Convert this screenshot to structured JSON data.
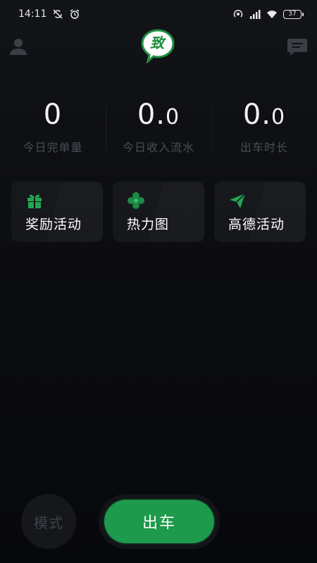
{
  "status_bar": {
    "time": "14:11",
    "battery": "37",
    "icons": [
      "sync-off-icon",
      "alarm-icon",
      "hotspot-icon",
      "signal-icon",
      "wifi-icon",
      "battery-icon"
    ]
  },
  "header": {
    "logo_text": "致",
    "left_icon": "user-icon",
    "right_icon": "message-icon"
  },
  "stats": [
    {
      "value": "0",
      "label": "今日完单量"
    },
    {
      "value_int": "0.",
      "value_dec": "0",
      "label": "今日收入流水"
    },
    {
      "value_int": "0.",
      "value_dec": "0",
      "label": "出车时长"
    }
  ],
  "cards": [
    {
      "label": "奖励活动",
      "icon": "gift-icon"
    },
    {
      "label": "热力图",
      "icon": "heatmap-icon"
    },
    {
      "label": "高德活动",
      "icon": "paper-plane-icon"
    }
  ],
  "bottom": {
    "mode_label": "模式",
    "depart_label": "出车"
  },
  "colors": {
    "accent": "#1d9a4b",
    "background": "#0b0c10",
    "muted_text": "#4a4d55"
  }
}
